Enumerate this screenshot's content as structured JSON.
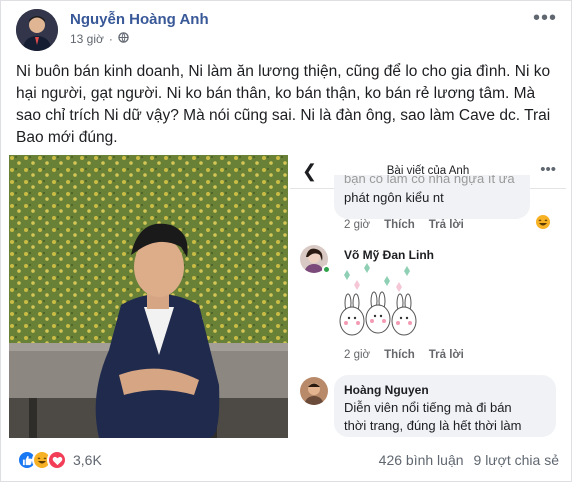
{
  "post": {
    "author": "Nguyễn Hoàng Anh",
    "time": "13 giờ",
    "separator": "·",
    "privacy_icon": "globe-icon",
    "more_icon": "ellipsis-icon",
    "text": "Ni buôn bán kinh doanh, Ni làm ăn lương thiện, cũng để lo cho gia đình. Ni ko hại người, gạt người. Ni ko bán thân, ko bán thận, ko bán rẻ lương tâm. Mà sao chỉ trích Ni dữ vậy? Mà nói cũng sai. Ni là đàn ông, sao làm Cave dc. Trai Bao mới đúng."
  },
  "screenshot": {
    "title": "Bài viết của Anh",
    "back_icon": "back-arrow-icon",
    "more_icon": "ellipsis-icon",
    "comments": [
      {
        "text_top_cut": "bạn cổ làm cô nhá ngựa ít ưa",
        "text": "phát ngôn kiểu nt",
        "time": "2 giờ",
        "like": "Thích",
        "reply": "Trả lời",
        "reaction_icon": "haha-icon"
      },
      {
        "name": "Võ Mỹ Đan Linh",
        "sticker": "bunny-sticker",
        "time": "2 giờ",
        "like": "Thích",
        "reply": "Trả lời"
      },
      {
        "name": "Hoàng Nguyen",
        "text_line1": "Diễn viên nổi tiếng mà đi bán",
        "text_line2": "thời trang, đúng là hết thời làm"
      }
    ]
  },
  "footer": {
    "reaction_icons": [
      "like-icon",
      "haha-icon",
      "love-icon"
    ],
    "reaction_count": "3,6K",
    "comments": "426 bình luận",
    "shares": "9 lượt chia sẻ"
  },
  "colors": {
    "author": "#385898",
    "like": "#1877f2",
    "haha": "#f7b125",
    "love": "#f33e58"
  }
}
